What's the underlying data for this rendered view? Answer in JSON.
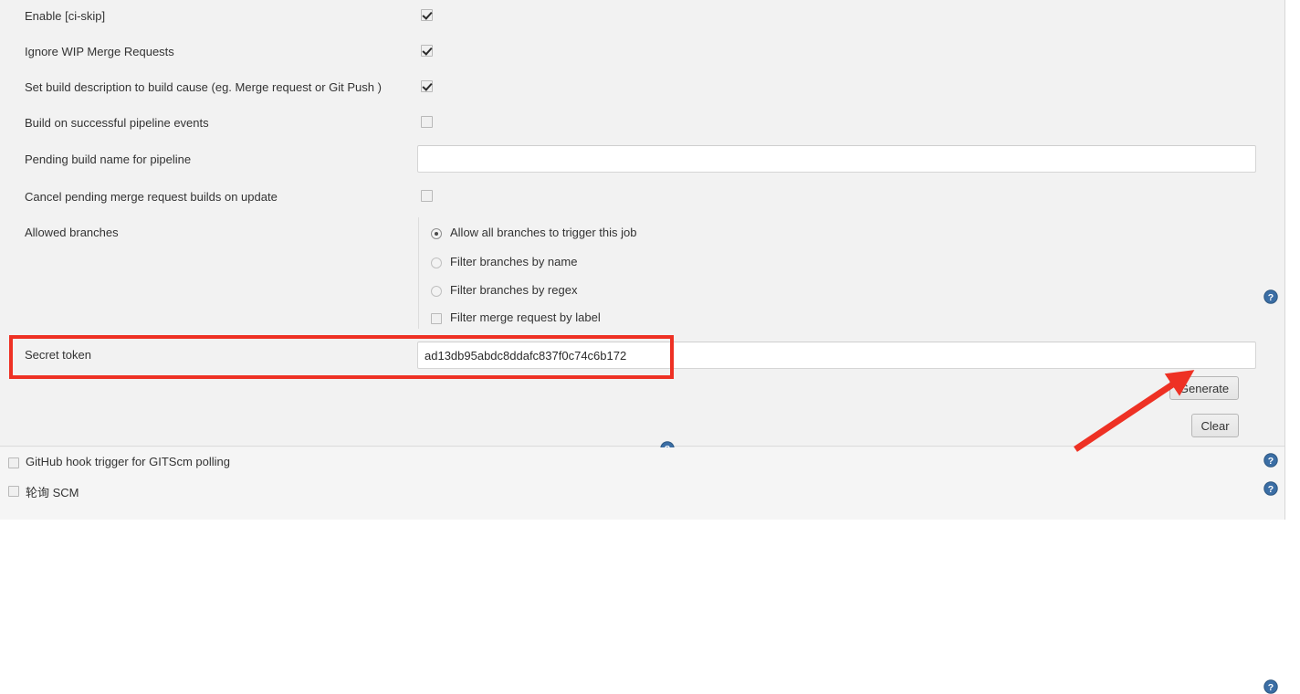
{
  "colors": {
    "panel_bg": "#f2f2f2",
    "panel_bg_alt": "#f5f5f5",
    "text": "#333333",
    "help_icon": "#3b6ea5",
    "annotation_red": "#ee3124",
    "input_border": "#d5d5d5",
    "button_face": "#e9e9e9"
  },
  "form": {
    "rows": [
      {
        "label": "Enable [ci-skip]",
        "control": "checkbox",
        "checked": true
      },
      {
        "label": "Ignore WIP Merge Requests",
        "control": "checkbox",
        "checked": true
      },
      {
        "label": "Set build description to build cause (eg. Merge request or Git Push )",
        "control": "checkbox",
        "checked": true
      },
      {
        "label": "Build on successful pipeline events",
        "control": "checkbox",
        "checked": false
      },
      {
        "label": "Pending build name for pipeline",
        "control": "text",
        "value": "",
        "placeholder": ""
      },
      {
        "label": "Cancel pending merge request builds on update",
        "control": "checkbox",
        "checked": false
      },
      {
        "label": "Allowed branches",
        "control": "radiogroup"
      },
      {
        "label": "Secret token",
        "control": "text",
        "value": "ad13db95abdc8ddafc837f0c74c6b172",
        "placeholder": ""
      }
    ],
    "allowed_branches": {
      "options": [
        {
          "label": "Allow all branches to trigger this job",
          "type": "radio",
          "selected": true
        },
        {
          "label": "Filter branches by name",
          "type": "radio",
          "selected": false
        },
        {
          "label": "Filter branches by regex",
          "type": "radio",
          "selected": false
        },
        {
          "label": "Filter merge request by label",
          "type": "checkbox",
          "selected": false
        }
      ]
    },
    "buttons": {
      "generate": "Generate",
      "clear": "Clear"
    }
  },
  "triggers": {
    "items": [
      {
        "label": "GitHub hook trigger for GITScm polling",
        "checked": false
      },
      {
        "label": "轮询 SCM",
        "checked": false
      }
    ]
  },
  "icons": {
    "help": "help-circle-icon",
    "checkbox": "checkbox-icon",
    "radio": "radio-button-icon"
  },
  "annotations": {
    "highlight_target": "Secret token",
    "arrow_target": "Generate"
  }
}
